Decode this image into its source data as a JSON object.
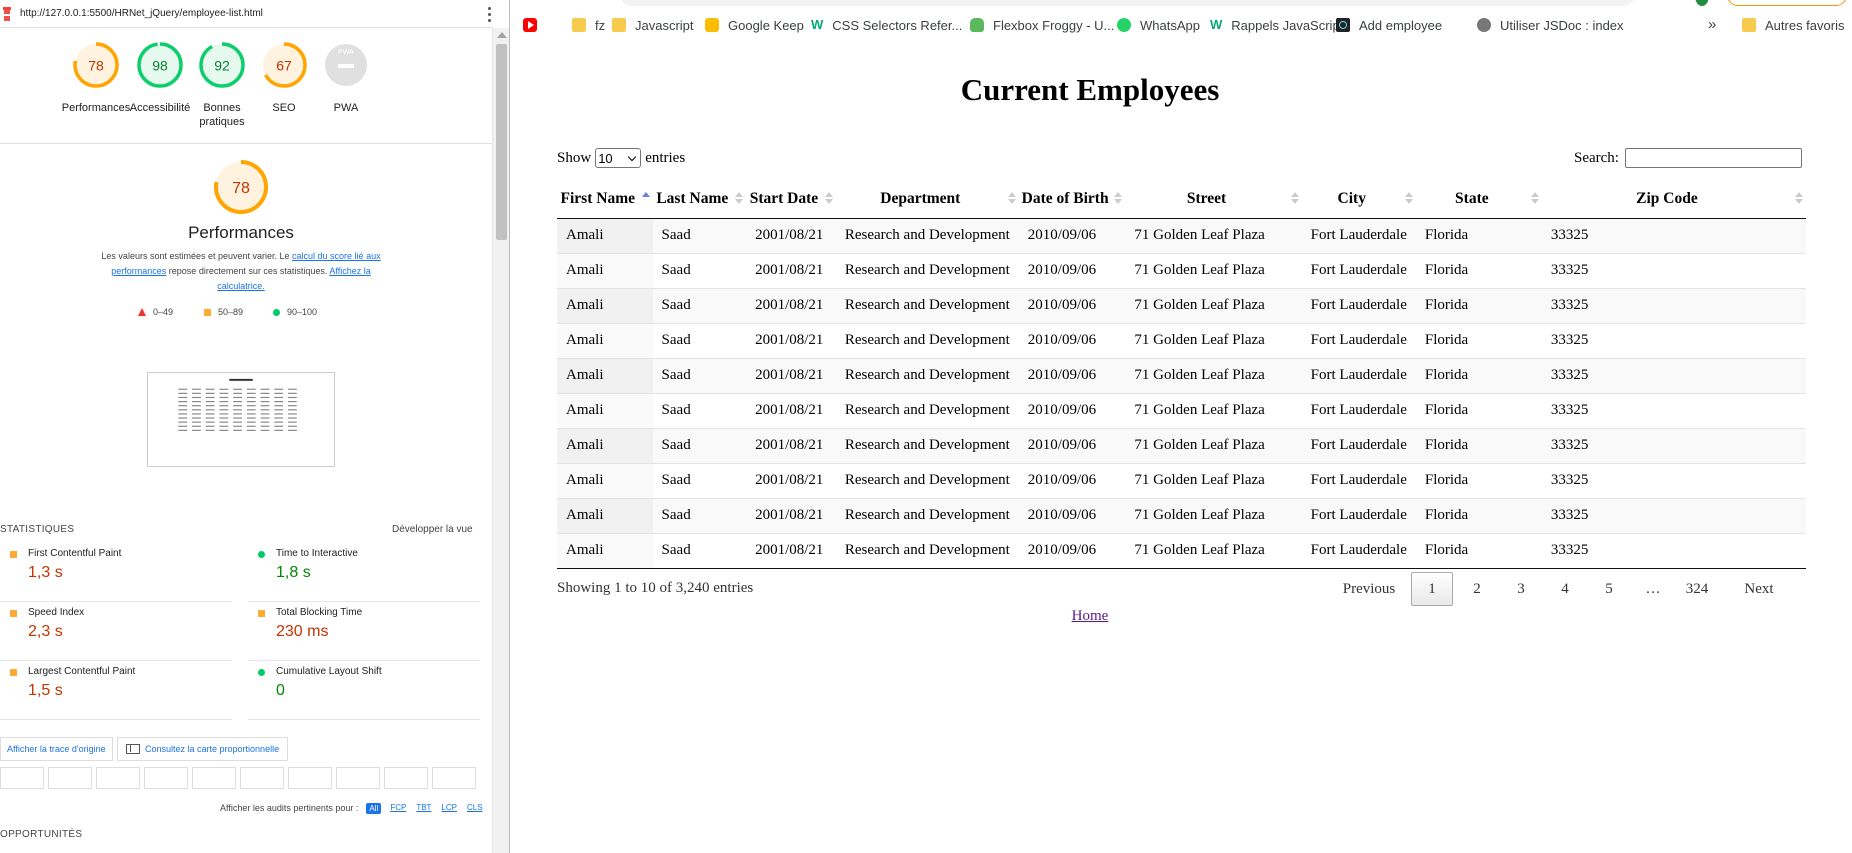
{
  "lighthouse": {
    "url": "http://127.0.0.1:5500/HRNet_jQuery/employee-list.html",
    "categories": [
      {
        "label": "Performances",
        "score": "78",
        "status": "average"
      },
      {
        "label": "Accessibilité",
        "score": "98",
        "status": "pass"
      },
      {
        "label": "Bonnes pratiques",
        "score": "92",
        "status": "pass"
      },
      {
        "label": "SEO",
        "score": "67",
        "status": "average"
      },
      {
        "label": "PWA",
        "score": "PWA",
        "status": "na"
      }
    ],
    "performance": {
      "score": "78",
      "title": "Performances",
      "desc_part1": "Les valeurs sont estimées et peuvent varier. Le ",
      "desc_link1": "calcul du score lié aux performances",
      "desc_part2": " repose directement sur ces statistiques. ",
      "desc_link2": "Affichez la calculatrice."
    },
    "legend": [
      {
        "range": "0–49",
        "color": "#e33"
      },
      {
        "range": "50–89",
        "color": "#fa3"
      },
      {
        "range": "90–100",
        "color": "#0c6"
      }
    ],
    "stats_title": "STATISTIQUES",
    "expand_label": "Développer la vue",
    "metrics": [
      {
        "name": "First Contentful Paint",
        "value": "1,3 s",
        "status": "average"
      },
      {
        "name": "Time to Interactive",
        "value": "1,8 s",
        "status": "pass"
      },
      {
        "name": "Speed Index",
        "value": "2,3 s",
        "status": "average"
      },
      {
        "name": "Total Blocking Time",
        "value": "230 ms",
        "status": "average"
      },
      {
        "name": "Largest Contentful Paint",
        "value": "1,5 s",
        "status": "average"
      },
      {
        "name": "Cumulative Layout Shift",
        "value": "0",
        "status": "pass"
      }
    ],
    "trace_button": "Afficher la trace d'origine",
    "map_button": "Consultez la carte proportionnelle",
    "audits_label": "Afficher les audits pertinents pour :",
    "audit_filters": [
      "All",
      "FCP",
      "TBT",
      "LCP",
      "CLS"
    ],
    "opportunities_title": "OPPORTUNITÉS"
  },
  "bookmarks": [
    {
      "label": "",
      "icon": "youtube-icon"
    },
    {
      "label": "fz",
      "icon": "folder-icon"
    },
    {
      "label": "Javascript",
      "icon": "folder-icon"
    },
    {
      "label": "Google Keep",
      "icon": "keep-icon"
    },
    {
      "label": "CSS Selectors Refer...",
      "icon": "w3schools-icon"
    },
    {
      "label": "Flexbox Froggy - U...",
      "icon": "froggy-icon"
    },
    {
      "label": "WhatsApp",
      "icon": "whatsapp-icon"
    },
    {
      "label": "Rappels JavaScript",
      "icon": "w3schools-icon"
    },
    {
      "label": "Add employee",
      "icon": "react-icon"
    },
    {
      "label": "Utiliser JSDoc : index",
      "icon": "globe-icon"
    },
    {
      "label": "Autres favoris",
      "icon": "folder-icon"
    }
  ],
  "bookmarks_more": "»",
  "page": {
    "title": "Current Employees",
    "show_label": "Show",
    "entries_label": "entries",
    "page_size": "10",
    "search_label": "Search:",
    "search_value": "",
    "columns": [
      "First Name",
      "Last Name",
      "Start Date",
      "Department",
      "Date of Birth",
      "Street",
      "City",
      "State",
      "Zip Code"
    ],
    "sorted_column": "First Name",
    "rows": [
      [
        "Amali",
        "Saad",
        "2001/08/21",
        "Research and Development",
        "2010/09/06",
        "71 Golden Leaf Plaza",
        "Fort Lauderdale",
        "Florida",
        "33325"
      ],
      [
        "Amali",
        "Saad",
        "2001/08/21",
        "Research and Development",
        "2010/09/06",
        "71 Golden Leaf Plaza",
        "Fort Lauderdale",
        "Florida",
        "33325"
      ],
      [
        "Amali",
        "Saad",
        "2001/08/21",
        "Research and Development",
        "2010/09/06",
        "71 Golden Leaf Plaza",
        "Fort Lauderdale",
        "Florida",
        "33325"
      ],
      [
        "Amali",
        "Saad",
        "2001/08/21",
        "Research and Development",
        "2010/09/06",
        "71 Golden Leaf Plaza",
        "Fort Lauderdale",
        "Florida",
        "33325"
      ],
      [
        "Amali",
        "Saad",
        "2001/08/21",
        "Research and Development",
        "2010/09/06",
        "71 Golden Leaf Plaza",
        "Fort Lauderdale",
        "Florida",
        "33325"
      ],
      [
        "Amali",
        "Saad",
        "2001/08/21",
        "Research and Development",
        "2010/09/06",
        "71 Golden Leaf Plaza",
        "Fort Lauderdale",
        "Florida",
        "33325"
      ],
      [
        "Amali",
        "Saad",
        "2001/08/21",
        "Research and Development",
        "2010/09/06",
        "71 Golden Leaf Plaza",
        "Fort Lauderdale",
        "Florida",
        "33325"
      ],
      [
        "Amali",
        "Saad",
        "2001/08/21",
        "Research and Development",
        "2010/09/06",
        "71 Golden Leaf Plaza",
        "Fort Lauderdale",
        "Florida",
        "33325"
      ],
      [
        "Amali",
        "Saad",
        "2001/08/21",
        "Research and Development",
        "2010/09/06",
        "71 Golden Leaf Plaza",
        "Fort Lauderdale",
        "Florida",
        "33325"
      ],
      [
        "Amali",
        "Saad",
        "2001/08/21",
        "Research and Development",
        "2010/09/06",
        "71 Golden Leaf Plaza",
        "Fort Lauderdale",
        "Florida",
        "33325"
      ]
    ],
    "info": "Showing 1 to 10 of 3,240 entries",
    "pagination": {
      "previous": "Previous",
      "pages": [
        "1",
        "2",
        "3",
        "4",
        "5",
        "…",
        "324"
      ],
      "current": "1",
      "next": "Next"
    },
    "home_link": "Home"
  },
  "colors": {
    "pass": "#0cce6b",
    "average": "#ffa400",
    "fail": "#ff4e42",
    "na": "#b8b8b8",
    "link": "#1a73e8",
    "visited_link": "#551a8b"
  }
}
